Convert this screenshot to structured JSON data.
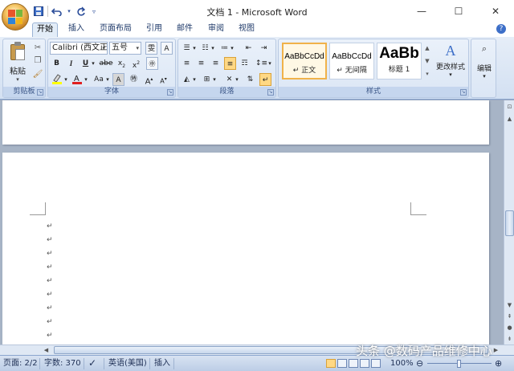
{
  "window": {
    "title": "文档 1 - Microsoft Word"
  },
  "quick_access": {
    "save": "save-icon",
    "undo": "undo-icon",
    "redo": "redo-icon",
    "customize": "customize-icon"
  },
  "tabs": [
    "开始",
    "插入",
    "页面布局",
    "引用",
    "邮件",
    "审阅",
    "视图"
  ],
  "active_tab": "开始",
  "ribbon": {
    "clipboard": {
      "paste_label": "粘贴",
      "group_label": "剪贴板"
    },
    "font": {
      "font_name": "Calibri (西文正",
      "font_size": "五号",
      "group_label": "字体"
    },
    "paragraph": {
      "group_label": "段落"
    },
    "styles": {
      "group_label": "样式",
      "items": [
        {
          "sample": "AaBbCcDd",
          "name": "↵ 正文",
          "selected": true
        },
        {
          "sample": "AaBbCcDd",
          "name": "↵ 无间隔",
          "selected": false
        },
        {
          "sample": "AaBb",
          "name": "标题 1",
          "selected": false
        }
      ],
      "change_styles": "更改样式"
    },
    "editing": {
      "label": "编辑"
    }
  },
  "document": {
    "paragraph_mark": "↵",
    "empty_paragraph_count": 9
  },
  "status": {
    "page": "页面: 2/2",
    "words": "字数: 370",
    "language": "英语(美国)",
    "mode": "插入",
    "zoom": "100%"
  },
  "watermark": "头条 @数码产品维修中心"
}
